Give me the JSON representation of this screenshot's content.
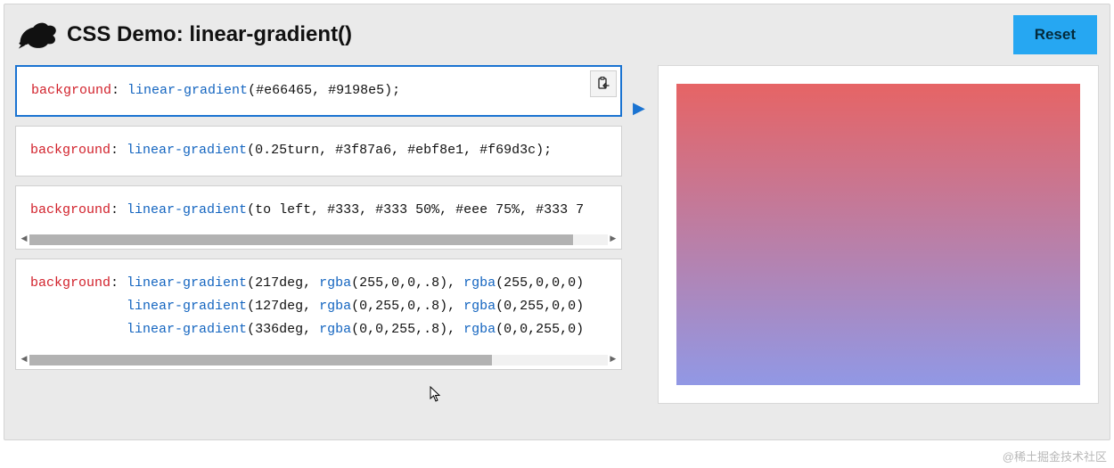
{
  "header": {
    "title": "CSS Demo: linear-gradient()",
    "reset_label": "Reset"
  },
  "pointer_glyph": "▶",
  "code_examples": [
    {
      "selected": true,
      "has_paste": true,
      "has_scroll": false,
      "prop": "background",
      "func1": "linear-gradient",
      "args1": "(#e66465, #9198e5);"
    },
    {
      "selected": false,
      "has_paste": false,
      "has_scroll": false,
      "prop": "background",
      "func1": "linear-gradient",
      "args1": "(0.25turn, #3f87a6, #ebf8e1, #f69d3c);"
    },
    {
      "selected": false,
      "has_paste": false,
      "has_scroll": true,
      "thumb_width": "94%",
      "prop": "background",
      "func1": "linear-gradient",
      "args1": "(to left, #333, #333 50%, #eee 75%, #333 7"
    },
    {
      "selected": false,
      "has_paste": false,
      "has_scroll": true,
      "thumb_width": "80%",
      "multi": true,
      "prop": "background",
      "lines": [
        {
          "func": "linear-gradient",
          "pre": "(217deg, ",
          "rgba1": "rgba",
          "a1": "(255,0,0,.8), ",
          "rgba2": "rgba",
          "a2": "(255,0,0,0)"
        },
        {
          "func": "linear-gradient",
          "pre": "(127deg, ",
          "rgba1": "rgba",
          "a1": "(0,255,0,.8), ",
          "rgba2": "rgba",
          "a2": "(0,255,0,0)"
        },
        {
          "func": "linear-gradient",
          "pre": "(336deg, ",
          "rgba1": "rgba",
          "a1": "(0,0,255,.8), ",
          "rgba2": "rgba",
          "a2": "(0,0,255,0)"
        }
      ]
    }
  ],
  "preview_css": "linear-gradient(#e66465, #9198e5)",
  "watermark": "@稀土掘金技术社区",
  "icons": {
    "paste": "clipboard-paste"
  }
}
